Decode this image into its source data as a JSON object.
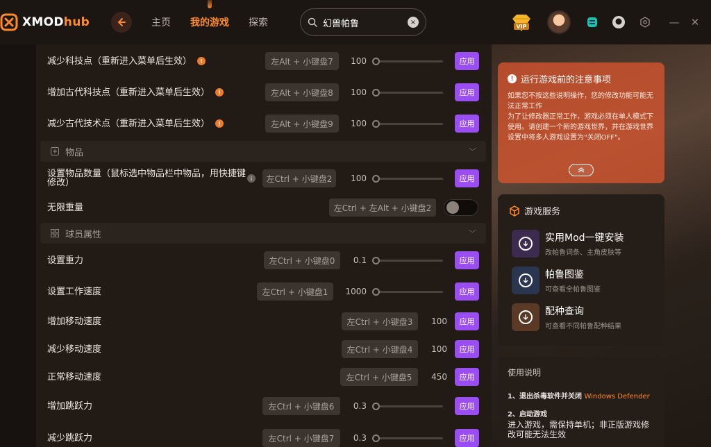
{
  "app": {
    "logo_main": "XMOD",
    "logo_accent": "hub"
  },
  "nav": {
    "items": [
      {
        "label": "主页",
        "active": false
      },
      {
        "label": "我的游戏",
        "active": true
      },
      {
        "label": "探索",
        "active": false
      }
    ]
  },
  "search": {
    "value": "幻兽帕鲁"
  },
  "colors": {
    "accent": "#ff8a2a",
    "apply": "#9a4df0",
    "notice": "#d0542e"
  },
  "rows": [
    {
      "label": "减少科技点（重新进入菜单后生效）",
      "warn": true,
      "hotkey": "左Alt + 小键盘7",
      "value": "100",
      "slider": true,
      "apply": "应用"
    },
    {
      "label": "增加古代科技点（重新进入菜单后生效）",
      "warn": true,
      "hotkey": "左Alt + 小键盘8",
      "value": "100",
      "slider": true,
      "apply": "应用"
    },
    {
      "label": "减少古代技术点（重新进入菜单后生效）",
      "warn": true,
      "hotkey": "左Alt + 小键盘9",
      "value": "100",
      "slider": true,
      "apply": "应用"
    }
  ],
  "section_items": {
    "label": "物品"
  },
  "rows_items": [
    {
      "label": "设置物品数量（鼠标选中物品栏中物品，用快捷键修改）",
      "hotkey": "左Ctrl + 小键盘2",
      "value": "100",
      "apply": "应用"
    },
    {
      "label": "无限重量",
      "hotkey": "左Ctrl + 左Alt + 小键盘2"
    }
  ],
  "section_player": {
    "label": "球员属性"
  },
  "rows_player": [
    {
      "label": "设置重力",
      "hotkey": "左Ctrl + 小键盘0",
      "value": "0.1",
      "slider": true,
      "apply": "应用"
    },
    {
      "label": "设置工作速度",
      "hotkey": "左Ctrl + 小键盘1",
      "value": "1000",
      "slider": true,
      "apply": "应用"
    },
    {
      "label": "增加移动速度",
      "hotkey": "左Ctrl + 小键盘3",
      "value": "100",
      "slider": false,
      "apply": "应用"
    },
    {
      "label": "减少移动速度",
      "hotkey": "左Ctrl + 小键盘4",
      "value": "100",
      "slider": false,
      "apply": "应用"
    },
    {
      "label": "正常移动速度",
      "hotkey": "左Ctrl + 小键盘5",
      "value": "450",
      "slider": false,
      "apply": "应用"
    },
    {
      "label": "增加跳跃力",
      "hotkey": "左Ctrl + 小键盘6",
      "value": "0.3",
      "slider": true,
      "apply": "应用"
    },
    {
      "label": "减少跳跃力",
      "hotkey": "左Ctrl + 小键盘7",
      "value": "0.3",
      "slider": true,
      "apply": "应用"
    }
  ],
  "notice": {
    "title": "运行游戏前的注意事项",
    "text1": "如果您不按这些说明操作，您的修改功能可能无法正常工作",
    "text2": "为了让修改器正常工作，游戏必须在单人模式下使用。请创建一个新的游戏世界，并在游戏世界设置中将多人游戏设置为\"关闭OFF\"。"
  },
  "services": {
    "title": "游戏服务",
    "items": [
      {
        "name": "实用Mod一键安装",
        "sub": "改帕鲁词条、主角皮肤等",
        "color": "#3d2a4f"
      },
      {
        "name": "帕鲁图鉴",
        "sub": "可查看全帕鲁图鉴",
        "color": "#2a3550"
      },
      {
        "name": "配种查询",
        "sub": "可查看不同帕鲁配种结果",
        "color": "#5a3a25"
      }
    ]
  },
  "usage": {
    "title": "使用说明",
    "step1": "1、退出杀毒软件并关闭",
    "step1_hl": "Windows Defender",
    "step2": "2、启动游戏",
    "step2_desc": "进入游戏，需保持单机；非正版游戏修改可能无法生效"
  }
}
